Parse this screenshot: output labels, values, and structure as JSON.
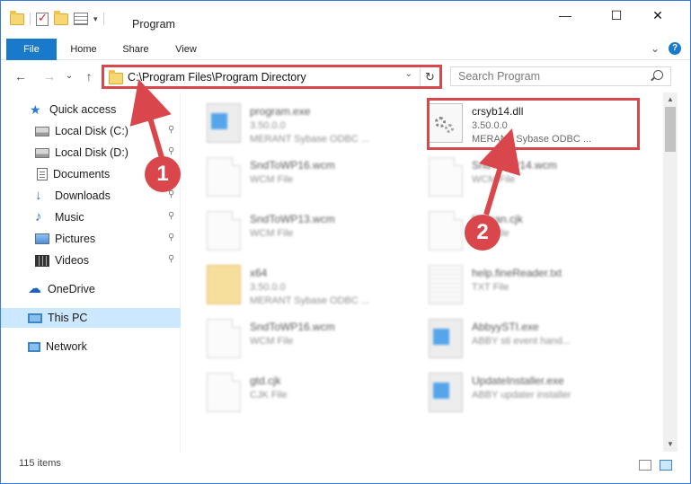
{
  "titlebar": {
    "title": "Program",
    "minimize_glyph": "—",
    "maximize_glyph": "☐",
    "close_glyph": "✕"
  },
  "ribbon": {
    "tabs": [
      "File",
      "Home",
      "Share",
      "View"
    ],
    "expand_glyph": "⌄",
    "help_glyph": "?"
  },
  "nav": {
    "back_glyph": "←",
    "forward_glyph": "→",
    "recent_glyph": "⌄",
    "up_glyph": "↑",
    "address": "C:\\Program Files\\Program Directory",
    "address_drop_glyph": "⌄",
    "refresh_glyph": "↻",
    "search_placeholder": "Search Program"
  },
  "sidebar": {
    "items": [
      {
        "label": "Quick access",
        "icon": "star-icon",
        "pinned": false
      },
      {
        "label": "Local Disk (C:)",
        "icon": "drive-icon",
        "pinned": true
      },
      {
        "label": "Local Disk (D:)",
        "icon": "drive-icon",
        "pinned": true
      },
      {
        "label": "Documents",
        "icon": "documents-icon",
        "pinned": true
      },
      {
        "label": "Downloads",
        "icon": "downloads-icon",
        "pinned": true
      },
      {
        "label": "Music",
        "icon": "music-icon",
        "pinned": true
      },
      {
        "label": "Pictures",
        "icon": "pictures-icon",
        "pinned": true
      },
      {
        "label": "Videos",
        "icon": "videos-icon",
        "pinned": true
      },
      {
        "label": "OneDrive",
        "icon": "cloud-icon",
        "pinned": false
      },
      {
        "label": "This PC",
        "icon": "pc-icon",
        "pinned": false,
        "selected": true
      },
      {
        "label": "Network",
        "icon": "network-icon",
        "pinned": false
      }
    ],
    "pin_glyph": "📌"
  },
  "files": [
    {
      "name": "program.exe",
      "line2": "3.50.0.0",
      "line3": "MERANT Sybase ODBC ...",
      "kind": "exe",
      "blurred": true
    },
    {
      "name": "crsyb14.dll",
      "line2": "3.50.0.0",
      "line3": "MERANT Sybase ODBC ...",
      "kind": "dll",
      "blurred": false,
      "highlighted": true
    },
    {
      "name": "SndToWP16.wcm",
      "line2": "WCM File",
      "line3": "",
      "kind": "doc",
      "blurred": true
    },
    {
      "name": "SndToWP14.wcm",
      "line2": "WCM File",
      "line3": "",
      "kind": "doc",
      "blurred": true
    },
    {
      "name": "SndToWP13.wcm",
      "line2": "WCM File",
      "line3": "",
      "kind": "doc",
      "blurred": true
    },
    {
      "name": "Korean.cjk",
      "line2": "CJK File",
      "line3": "",
      "kind": "doc",
      "blurred": true
    },
    {
      "name": "x64",
      "line2": "3.50.0.0",
      "line3": "MERANT Sybase ODBC ...",
      "kind": "folder",
      "blurred": true
    },
    {
      "name": "help.fineReader.txt",
      "line2": "TXT File",
      "line3": "",
      "kind": "txt",
      "blurred": true
    },
    {
      "name": "SndToWP16.wcm",
      "line2": "WCM File",
      "line3": "",
      "kind": "doc",
      "blurred": true
    },
    {
      "name": "AbbyySTI.exe",
      "line2": "ABBY sti event hand...",
      "line3": "",
      "kind": "exe",
      "blurred": true
    },
    {
      "name": "gtd.cjk",
      "line2": "CJK File",
      "line3": "",
      "kind": "doc",
      "blurred": true
    },
    {
      "name": "UpdateInstaller.exe",
      "line2": "ABBY updater installer",
      "line3": "",
      "kind": "exe",
      "blurred": true
    }
  ],
  "status": {
    "item_count": "115 items"
  },
  "annotations": [
    {
      "label": "1"
    },
    {
      "label": "2"
    }
  ],
  "colors": {
    "accent": "#1979ca",
    "highlight": "#d9474c",
    "selected_bg": "#cce8ff"
  }
}
